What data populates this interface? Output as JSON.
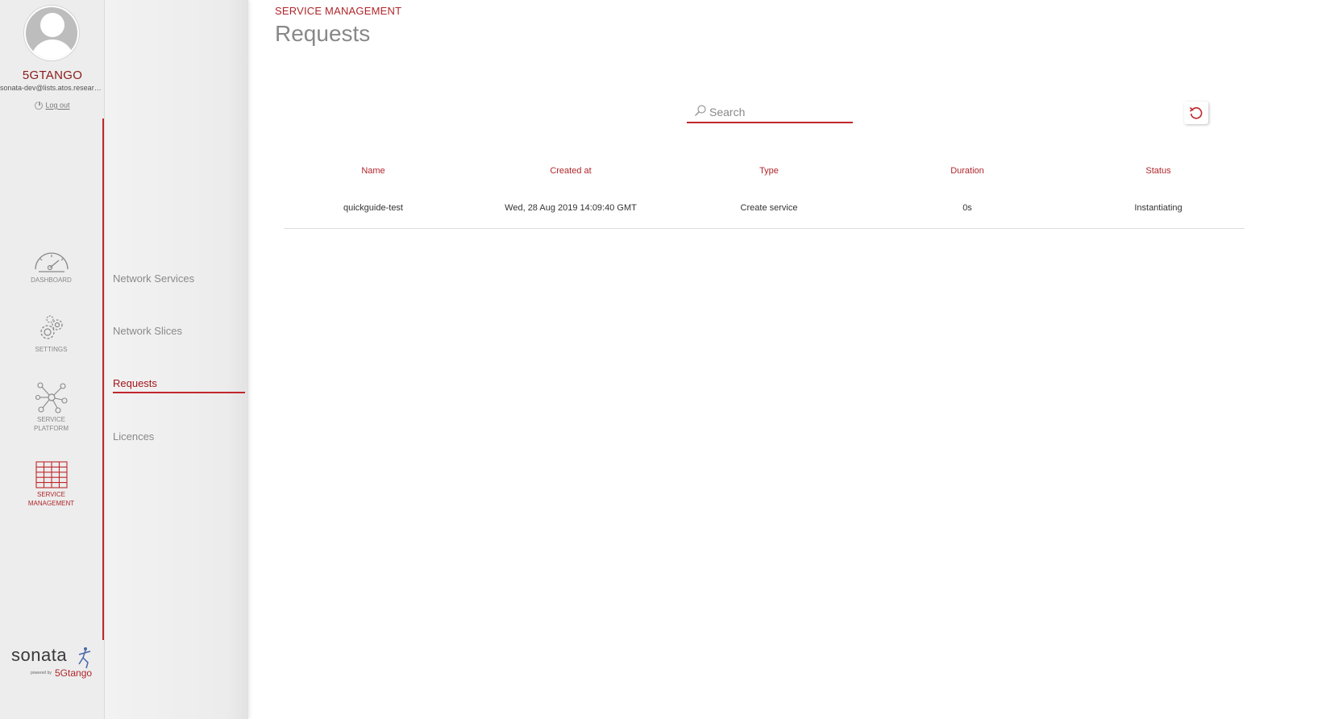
{
  "user": {
    "name": "5GTANGO",
    "email": "sonata-dev@lists.atos.research.net",
    "logout": "Log out"
  },
  "nav": [
    {
      "id": "dashboard",
      "label": "DASHBOARD",
      "icon": "gauge-icon"
    },
    {
      "id": "settings",
      "label": "SETTINGS",
      "icon": "gears-icon"
    },
    {
      "id": "service-platform",
      "label": "SERVICE PLATFORM",
      "icon": "network-hub-icon"
    },
    {
      "id": "service-management",
      "label": "SERVICE MANAGEMENT",
      "icon": "grid-icon",
      "active": true
    }
  ],
  "submenu": [
    {
      "label": "Network Services"
    },
    {
      "label": "Network Slices"
    },
    {
      "label": "Requests",
      "active": true
    },
    {
      "label": "Licences"
    }
  ],
  "brand": {
    "name": "sonata",
    "powered_by": "powered by",
    "partner": "5Gtango"
  },
  "header": {
    "section": "SERVICE MANAGEMENT",
    "title": "Requests"
  },
  "search": {
    "placeholder": "Search",
    "value": ""
  },
  "table": {
    "columns": [
      "Name",
      "Created at",
      "Type",
      "Duration",
      "Status"
    ],
    "rows": [
      [
        "quickguide-test",
        "Wed, 28 Aug 2019 14:09:40 GMT",
        "Create service",
        "0s",
        "Instantiating"
      ]
    ]
  },
  "colors": {
    "accent": "#c0272d",
    "accent_text": "#b0262b",
    "rail_bg": "#ededed"
  }
}
